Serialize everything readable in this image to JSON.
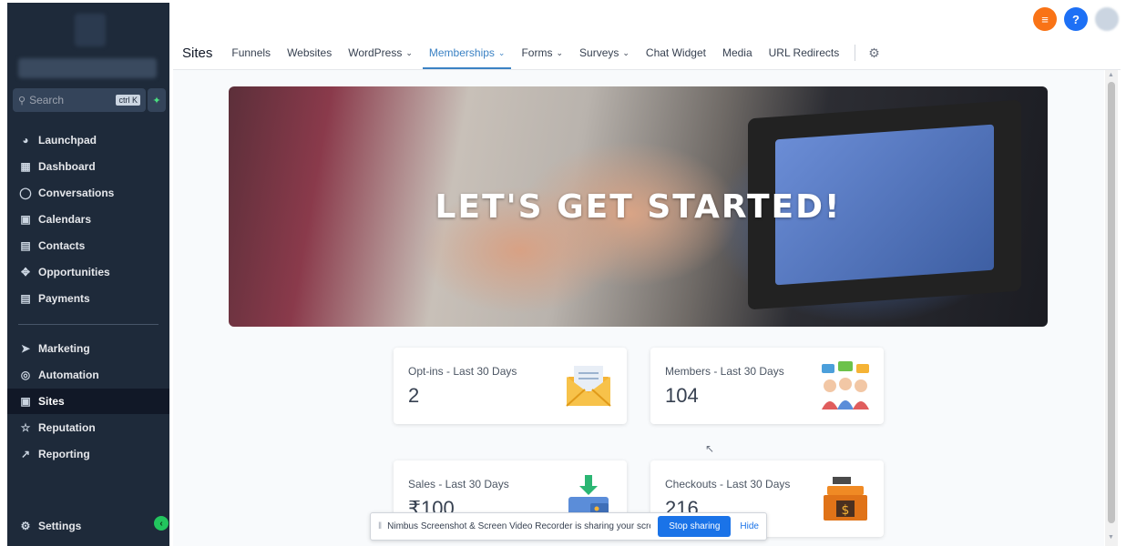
{
  "topbar": {
    "icons": [
      "list-icon",
      "help-icon",
      "avatar"
    ],
    "help_label": "?"
  },
  "sidebar": {
    "search": {
      "placeholder": "Search",
      "shortcut": "ctrl K"
    },
    "items": [
      {
        "label": "Launchpad",
        "icon": "rocket-icon"
      },
      {
        "label": "Dashboard",
        "icon": "grid-icon"
      },
      {
        "label": "Conversations",
        "icon": "chat-icon"
      },
      {
        "label": "Calendars",
        "icon": "calendar-icon"
      },
      {
        "label": "Contacts",
        "icon": "contacts-icon"
      },
      {
        "label": "Opportunities",
        "icon": "pipeline-icon"
      },
      {
        "label": "Payments",
        "icon": "receipt-icon"
      },
      {
        "label": "Marketing",
        "icon": "send-icon"
      },
      {
        "label": "Automation",
        "icon": "automation-icon"
      },
      {
        "label": "Sites",
        "icon": "sites-icon",
        "active": true
      },
      {
        "label": "Reputation",
        "icon": "star-icon"
      },
      {
        "label": "Reporting",
        "icon": "chart-icon"
      }
    ],
    "settings_label": "Settings"
  },
  "tabs": {
    "title": "Sites",
    "items": [
      "Funnels",
      "Websites",
      "WordPress",
      "Memberships",
      "Forms",
      "Surveys",
      "Chat Widget",
      "Media",
      "URL Redirects"
    ],
    "active": "Memberships"
  },
  "hero": {
    "title": "LET'S GET STARTED!"
  },
  "cards": [
    {
      "label": "Opt-ins - Last 30 Days",
      "value": "2",
      "icon": "envelope-icon"
    },
    {
      "label": "Members - Last 30 Days",
      "value": "104",
      "icon": "members-icon"
    },
    {
      "label": "Sales - Last 30 Days",
      "value": "₹100",
      "icon": "wallet-icon"
    },
    {
      "label": "Checkouts - Last 30 Days",
      "value": "216",
      "icon": "cash-register-icon"
    }
  ],
  "sharebar": {
    "text": "Nimbus Screenshot & Screen Video Recorder is sharing your screen.",
    "stop_label": "Stop sharing",
    "hide_label": "Hide"
  },
  "colors": {
    "sidebar_bg": "#1e2a3a",
    "accent": "#3b82c4",
    "orange": "#f97316",
    "blue": "#1d70f5",
    "success": "#22c55e"
  }
}
